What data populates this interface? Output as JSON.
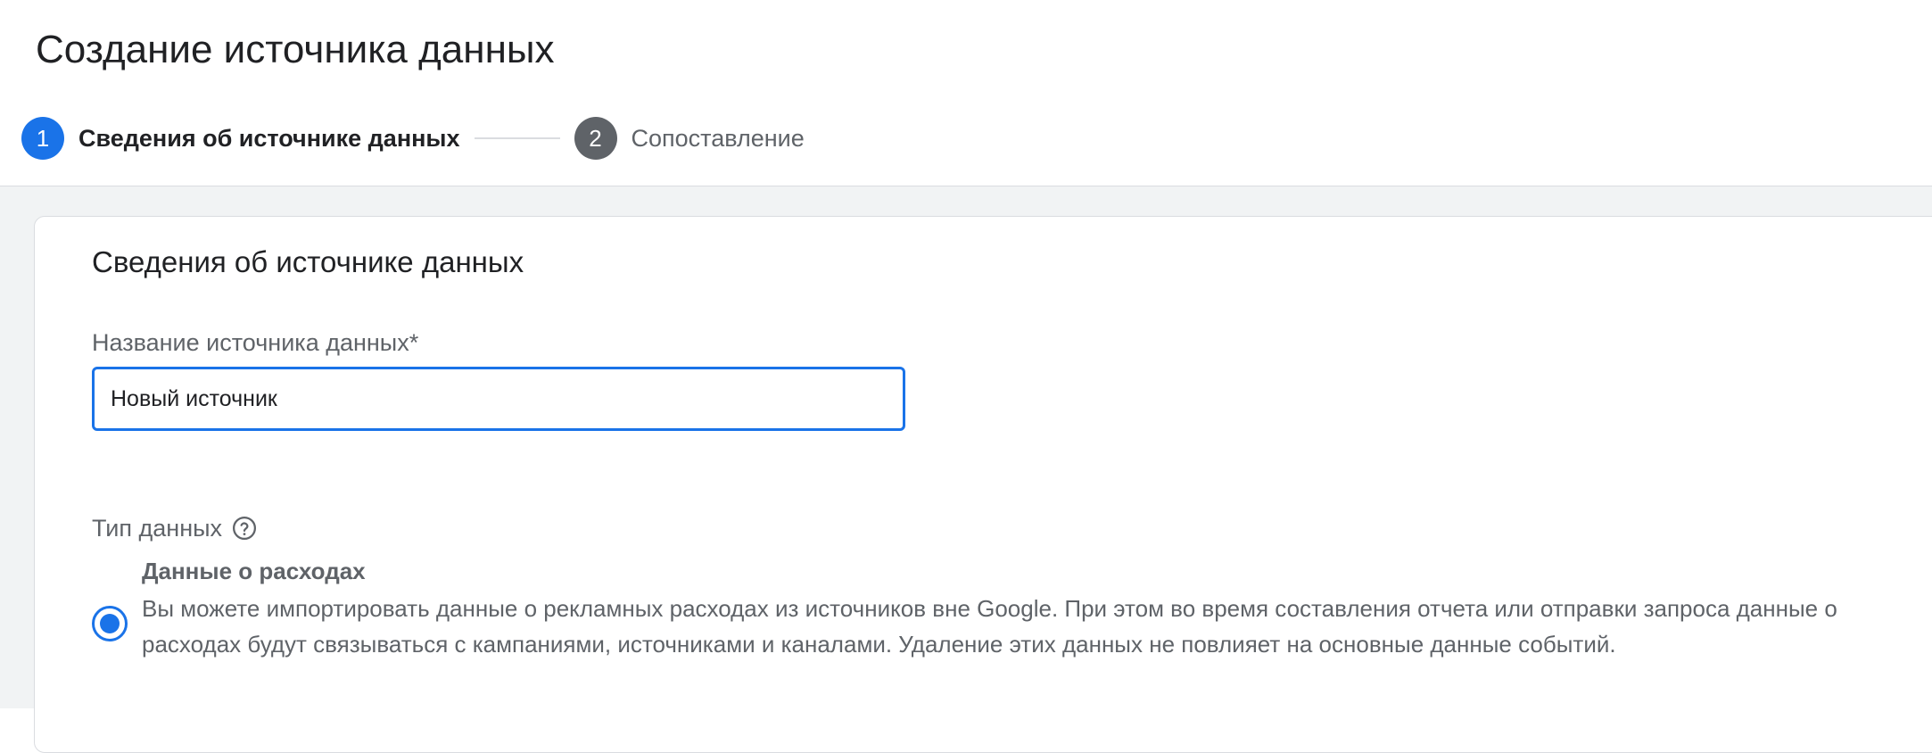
{
  "header": {
    "title": "Создание источника данных",
    "steps": [
      {
        "number": "1",
        "label": "Сведения об источнике данных",
        "state": "active"
      },
      {
        "number": "2",
        "label": "Сопоставление",
        "state": "inactive"
      }
    ]
  },
  "card": {
    "title": "Сведения об источнике данных",
    "name_field": {
      "label": "Название источника данных*",
      "value": "Новый источник"
    },
    "data_type": {
      "label": "Тип данных",
      "help_icon": "help-circle-icon",
      "options": [
        {
          "title": "Данные о расходах",
          "description": "Вы можете импортировать данные о рекламных расходах из источников вне Google. При этом во время составления отчета или отправки запроса данные о расходах будут связываться с кампаниями, источниками и каналами. Удаление этих данных не повлияет на основные данные событий.",
          "selected": true
        }
      ]
    }
  },
  "colors": {
    "accent": "#1a73e8",
    "inactive_step": "#5f6368",
    "secondary_text": "#5f6368",
    "content_background": "#f1f3f4",
    "border": "#dadce0"
  }
}
